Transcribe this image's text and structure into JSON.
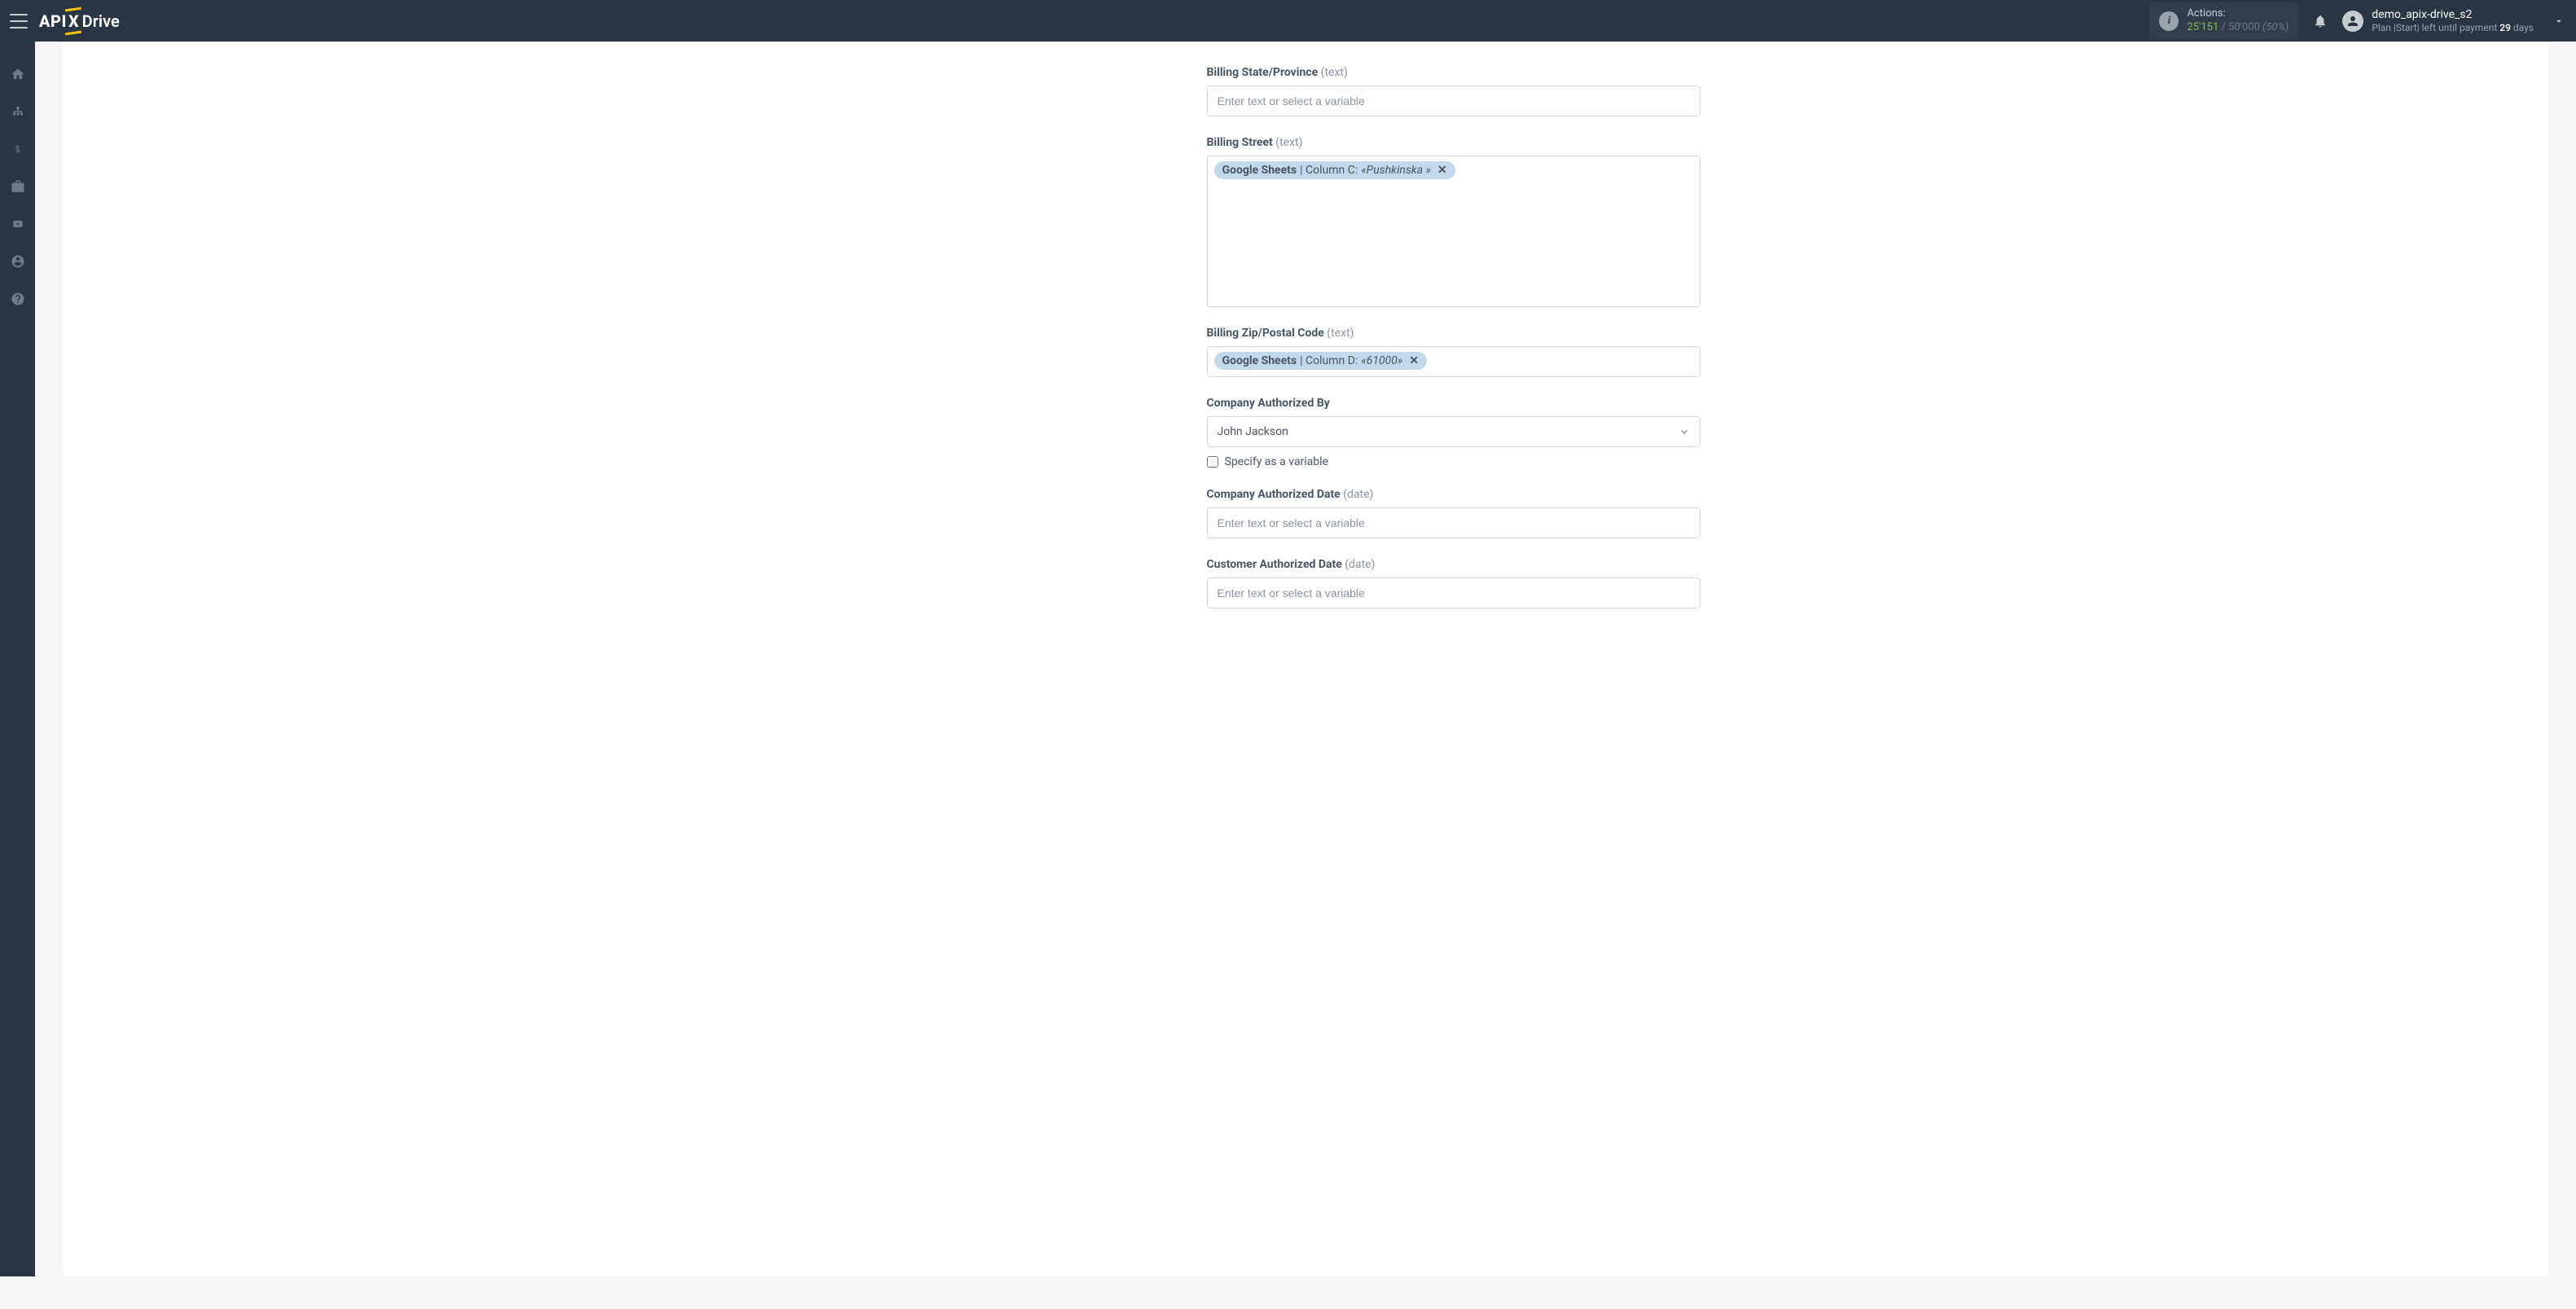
{
  "header": {
    "logo_api": "API",
    "logo_x": "X",
    "logo_drive": "Drive",
    "actions_label": "Actions:",
    "actions_used": "25'151",
    "actions_sep": " / ",
    "actions_total": "50'000",
    "actions_pct": "(50%)",
    "user_name": "demo_apix-drive_s2",
    "plan_prefix": "Plan |",
    "plan_name": "Start",
    "plan_mid": "| left until payment ",
    "plan_days": "29",
    "plan_suffix": " days"
  },
  "fields": {
    "billing_state": {
      "label": "Billing State/Province",
      "hint": "(text)",
      "placeholder": "Enter text or select a variable"
    },
    "billing_street": {
      "label": "Billing Street",
      "hint": "(text)",
      "pill_source": "Google Sheets",
      "pill_col": " | Column C: ",
      "pill_val": "«Pushkinska »",
      "pill_remove": "✕"
    },
    "billing_zip": {
      "label": "Billing Zip/Postal Code",
      "hint": "(text)",
      "pill_source": "Google Sheets",
      "pill_col": " | Column D: ",
      "pill_val": "«61000»",
      "pill_remove": "✕"
    },
    "company_auth_by": {
      "label": "Company Authorized By",
      "selected": "John Jackson",
      "checkbox_label": "Specify as a variable"
    },
    "company_auth_date": {
      "label": "Company Authorized Date",
      "hint": "(date)",
      "placeholder": "Enter text or select a variable"
    },
    "customer_auth_date": {
      "label": "Customer Authorized Date",
      "hint": "(date)",
      "placeholder": "Enter text or select a variable"
    }
  }
}
